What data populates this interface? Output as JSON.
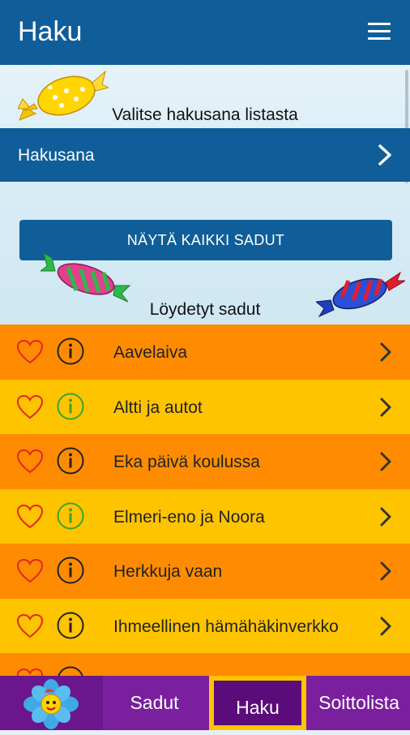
{
  "header": {
    "title": "Haku",
    "menu_icon": "hamburger-menu-icon"
  },
  "search": {
    "instruction": "Valitse hakusana listasta",
    "field_label": "Hakusana"
  },
  "show_all_button": "NÄYTÄ KAIKKI SADUT",
  "results_heading": "Löydetyt sadut",
  "colors": {
    "primary": "#0f5e99",
    "orange": "#ff8c00",
    "yellow": "#ffc400",
    "purple": "#7a1f9e"
  },
  "stories": [
    {
      "title": "Aavelaiva",
      "color": "orange"
    },
    {
      "title": "Altti ja autot",
      "color": "yellow"
    },
    {
      "title": "Eka päivä koulussa",
      "color": "orange"
    },
    {
      "title": "Elmeri-eno ja Noora",
      "color": "yellow"
    },
    {
      "title": "Herkkuja vaan",
      "color": "orange"
    },
    {
      "title": "Ihmeellinen hämähäkinverkko",
      "color": "yellow"
    }
  ],
  "bottom_nav": {
    "items": [
      {
        "label": "Sadut"
      },
      {
        "label": "Haku",
        "active": true
      },
      {
        "label": "Soittolista"
      }
    ]
  }
}
